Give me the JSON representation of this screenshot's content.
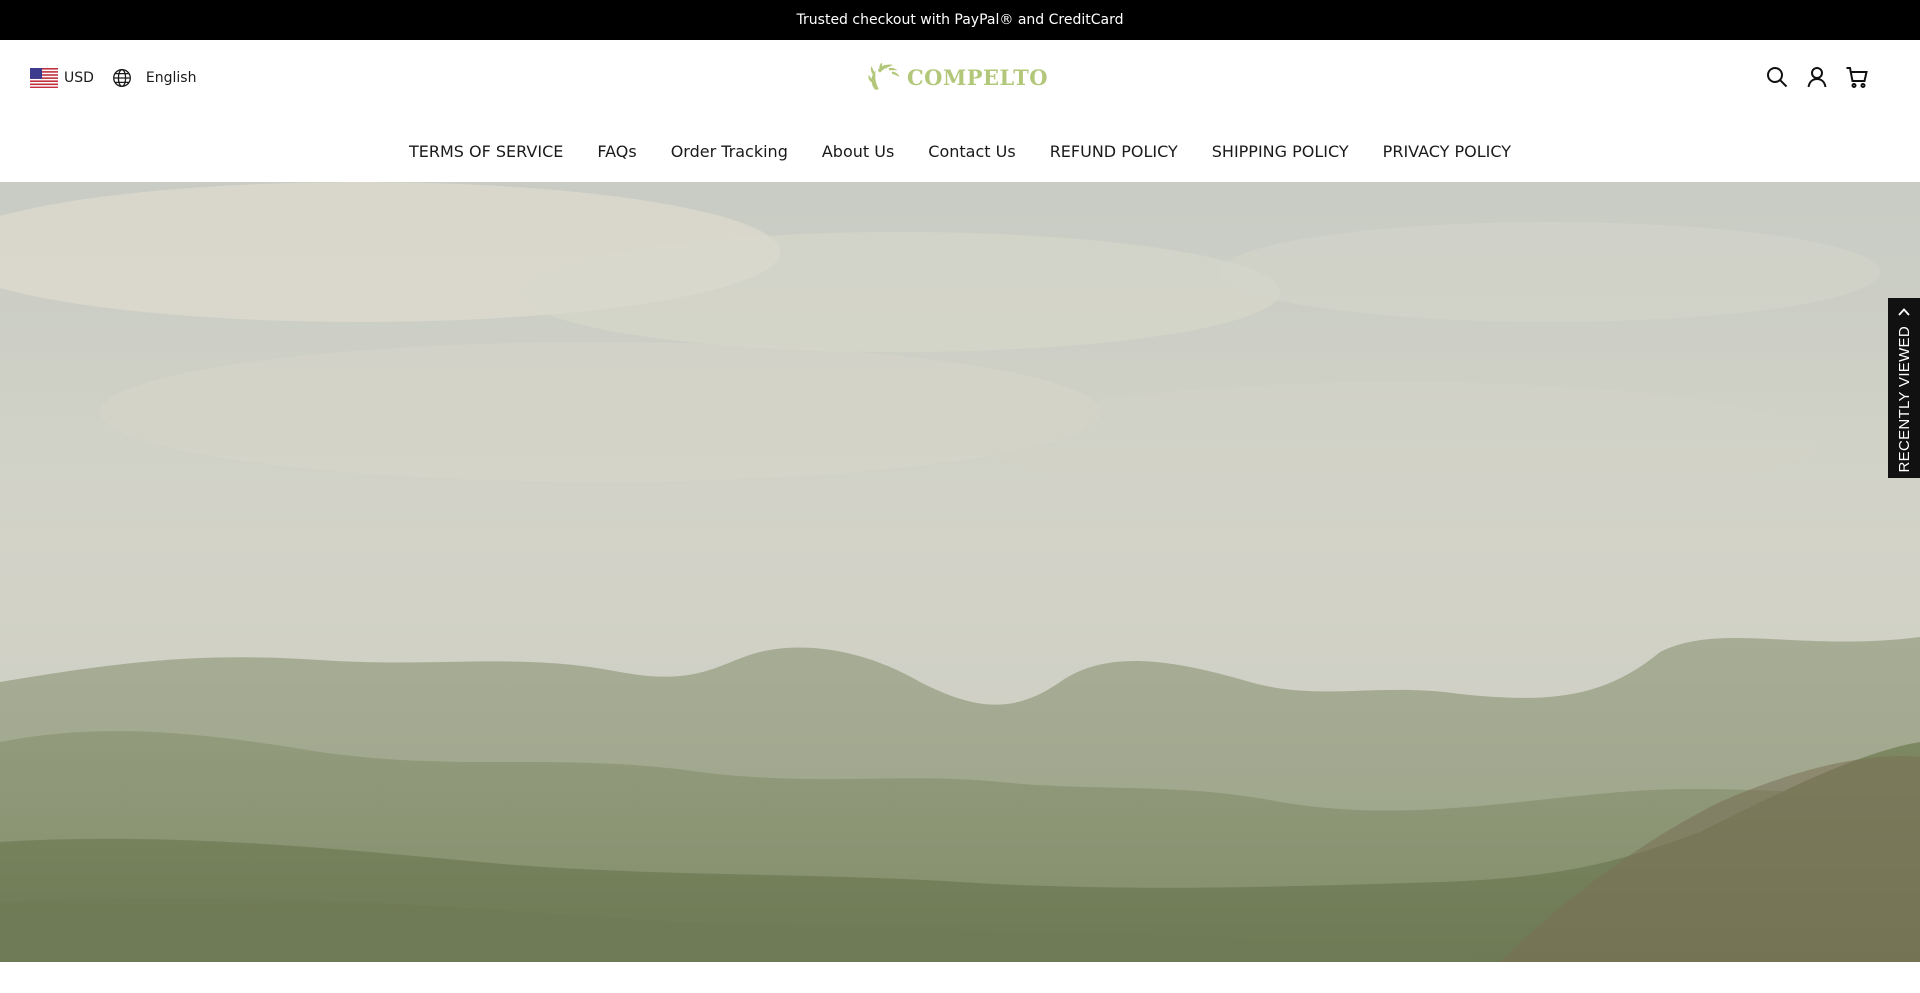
{
  "announcement": {
    "text": "Trusted checkout with PayPal® and CreditCard"
  },
  "header": {
    "currency": {
      "label": "USD",
      "flag_icon": "us-flag-icon"
    },
    "language": {
      "label": "English",
      "icon": "globe-icon"
    },
    "logo": {
      "text": "COMPELTO",
      "color": "#b3c77a"
    },
    "actions": [
      {
        "name": "search",
        "icon": "search-icon"
      },
      {
        "name": "account",
        "icon": "user-icon"
      },
      {
        "name": "cart",
        "icon": "cart-icon"
      }
    ]
  },
  "nav": {
    "items": [
      {
        "label": "TERMS OF SERVICE"
      },
      {
        "label": "FAQs"
      },
      {
        "label": "Order Tracking"
      },
      {
        "label": "About Us"
      },
      {
        "label": "Contact Us"
      },
      {
        "label": "REFUND POLICY"
      },
      {
        "label": "SHIPPING POLICY"
      },
      {
        "label": "PRIVACY POLICY"
      }
    ]
  },
  "hero": {
    "image_subject": "hazy green rolling hills under a pale cloudy sky"
  },
  "recently_viewed": {
    "label": "RECENTLY VIEWED",
    "icon": "chevron-up-icon"
  },
  "colors": {
    "announcement_bg": "#000000",
    "accent": "#b3c77a",
    "tab_bg": "#111111"
  }
}
